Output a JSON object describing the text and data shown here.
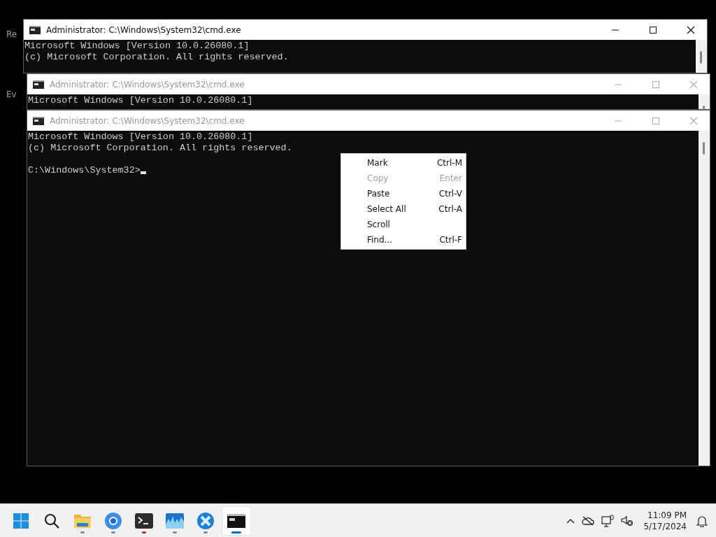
{
  "desktop": {
    "icon_labels": [
      "Re",
      "Ev"
    ]
  },
  "windows": [
    {
      "title": "Administrator: C:\\Windows\\System32\\cmd.exe",
      "active": true,
      "lines": [
        "Microsoft Windows [Version 10.0.26080.1]",
        "(c) Microsoft Corporation. All rights reserved."
      ]
    },
    {
      "title": "Administrator: C:\\Windows\\System32\\cmd.exe",
      "active": false,
      "lines": [
        "Microsoft Windows [Version 10.0.26080.1]"
      ]
    },
    {
      "title": "Administrator: C:\\Windows\\System32\\cmd.exe",
      "active": false,
      "lines": [
        "Microsoft Windows [Version 10.0.26080.1]",
        "(c) Microsoft Corporation. All rights reserved."
      ],
      "prompt": "C:\\Windows\\System32>",
      "cursor": true
    }
  ],
  "context_menu": {
    "items": [
      {
        "label": "Mark",
        "shortcut": "Ctrl-M",
        "disabled": false
      },
      {
        "label": "Copy",
        "shortcut": "Enter",
        "disabled": true
      },
      {
        "label": "Paste",
        "shortcut": "Ctrl-V",
        "disabled": false
      },
      {
        "label": "Select All",
        "shortcut": "Ctrl-A",
        "disabled": false
      },
      {
        "label": "Scroll",
        "disabled": false
      },
      {
        "label": "Find...",
        "shortcut": "Ctrl-F",
        "disabled": false
      }
    ]
  },
  "taskbar": {
    "apps": [
      {
        "kind": "start",
        "selected": false
      },
      {
        "kind": "search",
        "selected": false
      },
      {
        "kind": "folder",
        "running": true,
        "selected": false
      },
      {
        "kind": "browser",
        "running": true,
        "selected": false
      },
      {
        "kind": "terminal",
        "running": true,
        "selected": false
      },
      {
        "kind": "monitor",
        "running": true,
        "selected": false
      },
      {
        "kind": "tool",
        "running": true,
        "selected": false
      },
      {
        "kind": "console",
        "running": true,
        "selected": true
      }
    ],
    "clock": {
      "time": "11:09 PM",
      "date": "5/17/2024"
    }
  }
}
